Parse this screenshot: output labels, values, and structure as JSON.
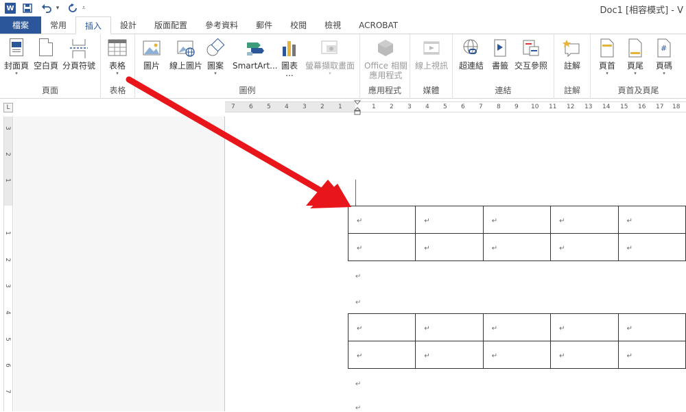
{
  "titlebar": {
    "app_icon": "W",
    "doc_title": "Doc1 [相容模式] - V"
  },
  "icons": {
    "save": "save-icon",
    "undo": "undo-icon",
    "redo": "redo-icon",
    "customize": "customize-qat-icon"
  },
  "tabs": [
    "檔案",
    "常用",
    "插入",
    "設計",
    "版面配置",
    "參考資料",
    "郵件",
    "校閱",
    "檢視",
    "ACROBAT"
  ],
  "active_tab": "插入",
  "ribbon": {
    "groups": {
      "pages": {
        "label": "頁面",
        "buttons": [
          "封面頁",
          "空白頁",
          "分頁符號"
        ]
      },
      "tables": {
        "label": "表格",
        "buttons": [
          "表格"
        ]
      },
      "illustrations": {
        "label": "圖例",
        "buttons": [
          "圖片",
          "線上圖片",
          "圖案",
          "SmartArt...",
          "圖表",
          "...",
          "螢幕擷取畫面"
        ]
      },
      "apps": {
        "label": "應用程式",
        "buttons": [
          "Office 相關",
          "應用程式"
        ]
      },
      "media": {
        "label": "媒體",
        "buttons": [
          "線上視訊"
        ]
      },
      "links": {
        "label": "連結",
        "buttons": [
          "超連結",
          "書籤",
          "交互參照"
        ]
      },
      "comments": {
        "label": "註解",
        "buttons": [
          "註解"
        ]
      },
      "header_footer": {
        "label": "頁首及頁尾",
        "buttons": [
          "頁首",
          "頁尾",
          "頁碼"
        ]
      }
    }
  },
  "ruler": {
    "corner": "L",
    "horizontal_left": [
      "7",
      "6",
      "5",
      "4",
      "3",
      "2",
      "1"
    ],
    "horizontal_right": [
      "1",
      "2",
      "3",
      "4",
      "5",
      "6",
      "7",
      "8",
      "9",
      "10",
      "11",
      "12",
      "13",
      "14",
      "15",
      "16",
      "17",
      "18"
    ],
    "vertical": [
      "3",
      "2",
      "1",
      "1",
      "2",
      "3",
      "4",
      "5",
      "6",
      "7"
    ]
  },
  "document": {
    "paragraph_mark": "↵",
    "tables": [
      {
        "rows": 2,
        "cols": 5
      },
      {
        "rows": 2,
        "cols": 5
      }
    ]
  },
  "colors": {
    "word_blue": "#2b579a",
    "annotation_arrow": "#e8161b"
  }
}
